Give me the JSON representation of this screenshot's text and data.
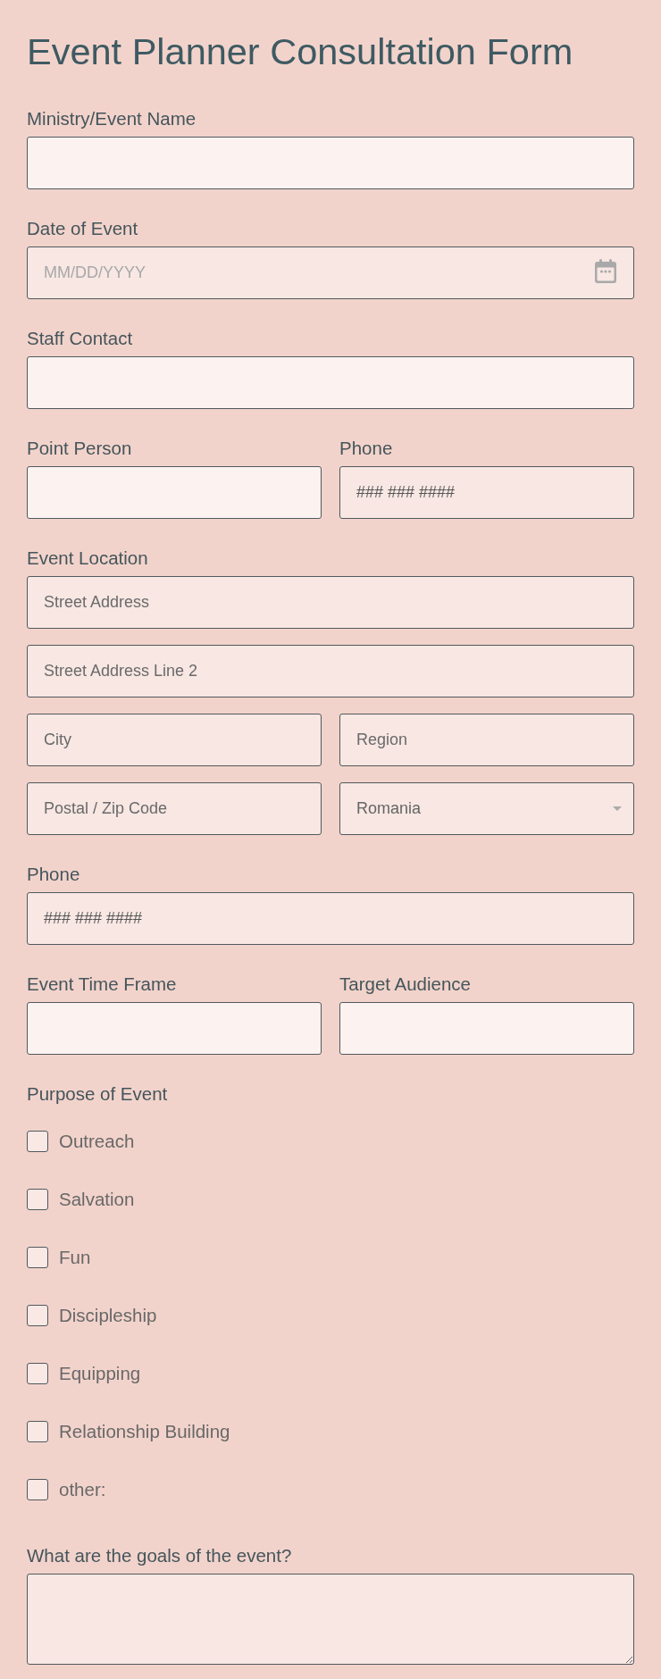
{
  "title": "Event Planner Consultation Form",
  "fields": [
    {
      "kind": "text",
      "label": "Ministry/Event Name"
    },
    {
      "kind": "date",
      "label": "Date of Event",
      "placeholder": "MM/DD/YYYY"
    },
    {
      "kind": "text",
      "label": "Staff Contact"
    },
    {
      "kind": "pair",
      "items": [
        {
          "kind": "text",
          "label": "Point Person"
        },
        {
          "kind": "phone",
          "label": "Phone",
          "placeholder": "### ### ####"
        }
      ]
    },
    {
      "kind": "address",
      "label": "Event Location",
      "street": {
        "placeholder": "Street Address"
      },
      "street_line_2": {
        "placeholder": "Street Address Line 2"
      },
      "city": {
        "placeholder": "City"
      },
      "region": {
        "placeholder": "Region"
      },
      "postal": {
        "placeholder": "Postal / Zip Code"
      },
      "country": {
        "value": "Romania"
      }
    },
    {
      "kind": "phone",
      "label": "Phone",
      "placeholder": "### ### ####"
    },
    {
      "kind": "pair",
      "items": [
        {
          "kind": "text",
          "label": "Event Time Frame"
        },
        {
          "kind": "text",
          "label": "Target Audience"
        }
      ]
    },
    {
      "kind": "checkboxes",
      "label": "Purpose of Event",
      "options": [
        {
          "label": "Outreach",
          "checked": false
        },
        {
          "label": "Salvation",
          "checked": false
        },
        {
          "label": "Fun",
          "checked": false
        },
        {
          "label": "Discipleship",
          "checked": false
        },
        {
          "label": "Equipping",
          "checked": false
        },
        {
          "label": "Relationship Building",
          "checked": false
        },
        {
          "label": "other:",
          "checked": false
        }
      ]
    },
    {
      "kind": "textarea",
      "label": "What are the goals of the event?"
    }
  ]
}
